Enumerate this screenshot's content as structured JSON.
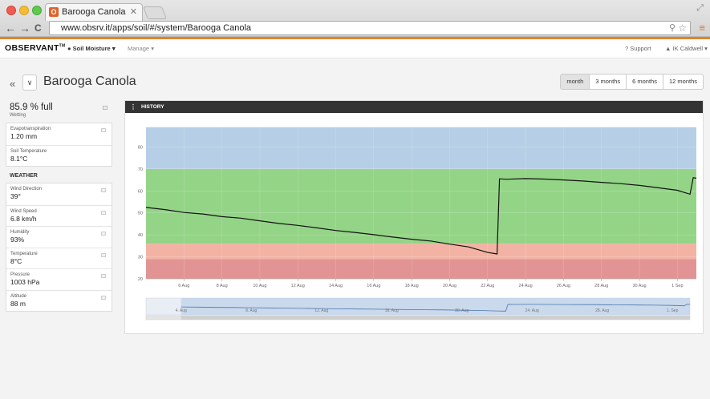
{
  "browser": {
    "tab_title": "Barooga Canola",
    "tab_favicon": "O",
    "tab_close": "✕",
    "url": "www.obsrv.it/apps/soil/#/system/Barooga Canola",
    "back_icon": "←",
    "forward_icon": "→",
    "reload_icon": "C",
    "menu_icon": "≡"
  },
  "app": {
    "logo": "OBSERVANT",
    "logo_tm": "TM",
    "nav_soil": "Soil Moisture",
    "nav_manage": "Manage",
    "support": "Support",
    "user": "IK Caldwell"
  },
  "page": {
    "back": "«",
    "dropdown": "∨",
    "title": "Barooga Canola",
    "ranges": [
      "month",
      "3 months",
      "6 months",
      "12 months"
    ]
  },
  "soil": {
    "value": "85.9 % full",
    "status": "Wetting"
  },
  "soil_card": [
    {
      "label": "Evapotranspiration",
      "value": "1.20 mm"
    },
    {
      "label": "Soil Temperature",
      "value": "8.1°C"
    }
  ],
  "weather_title": "WEATHER",
  "weather": [
    {
      "label": "Wind Direction",
      "value": "39°"
    },
    {
      "label": "Wind Speed",
      "value": "6.8 km/h"
    },
    {
      "label": "Humidity",
      "value": "93%"
    },
    {
      "label": "Temperature",
      "value": "8°C"
    },
    {
      "label": "Pressure",
      "value": "1003 hPa"
    },
    {
      "label": "Altitude",
      "value": "88 m"
    }
  ],
  "history_title": "HISTORY",
  "colors": {
    "accent": "#e0842a",
    "band_blue": "#b7cfe6",
    "band_green": "#94d487",
    "band_pink": "#f2b3a4",
    "band_red": "#e29494"
  },
  "chart_data": {
    "type": "line",
    "title": "HISTORY",
    "ylim": [
      20,
      90
    ],
    "yticks": [
      20,
      30,
      40,
      50,
      60,
      70,
      80
    ],
    "xlim": [
      "2013-08-04",
      "2013-09-02"
    ],
    "xticks": [
      "6 Aug",
      "8 Aug",
      "10 Aug",
      "12 Aug",
      "14 Aug",
      "16 Aug",
      "18 Aug",
      "20 Aug",
      "22 Aug",
      "24 Aug",
      "26 Aug",
      "28 Aug",
      "30 Aug",
      "1 Sep"
    ],
    "bands": [
      {
        "from": 70,
        "to": 89,
        "color": "#b7cfe6"
      },
      {
        "from": 36,
        "to": 70,
        "color": "#94d487"
      },
      {
        "from": 29,
        "to": 36,
        "color": "#f2b3a4"
      },
      {
        "from": 20,
        "to": 29,
        "color": "#e29494"
      }
    ],
    "series": [
      {
        "points": [
          [
            "2013-08-04T00:00",
            52.5
          ],
          [
            "2013-08-05T00:00",
            51.5
          ],
          [
            "2013-08-06T00:00",
            50.2
          ],
          [
            "2013-08-07T00:00",
            49.5
          ],
          [
            "2013-08-08T00:00",
            48.3
          ],
          [
            "2013-08-09T00:00",
            47.6
          ],
          [
            "2013-08-10T00:00",
            46.4
          ],
          [
            "2013-08-11T00:00",
            45.2
          ],
          [
            "2013-08-12T00:00",
            44.3
          ],
          [
            "2013-08-13T00:00",
            43.2
          ],
          [
            "2013-08-14T00:00",
            42.0
          ],
          [
            "2013-08-15T00:00",
            41.1
          ],
          [
            "2013-08-16T00:00",
            40.1
          ],
          [
            "2013-08-17T00:00",
            39.0
          ],
          [
            "2013-08-18T00:00",
            38.0
          ],
          [
            "2013-08-19T00:00",
            37.2
          ],
          [
            "2013-08-20T00:00",
            35.8
          ],
          [
            "2013-08-21T00:00",
            34.5
          ],
          [
            "2013-08-22T00:00",
            32.0
          ],
          [
            "2013-08-22T12:00",
            31.3
          ],
          [
            "2013-08-22T15:00",
            65.5
          ],
          [
            "2013-08-23T00:00",
            65.3
          ],
          [
            "2013-08-24T00:00",
            65.6
          ],
          [
            "2013-08-25T00:00",
            65.4
          ],
          [
            "2013-08-26T00:00",
            65.0
          ],
          [
            "2013-08-27T00:00",
            64.5
          ],
          [
            "2013-08-28T00:00",
            63.9
          ],
          [
            "2013-08-29T00:00",
            63.3
          ],
          [
            "2013-08-30T00:00",
            62.5
          ],
          [
            "2013-08-31T00:00",
            61.4
          ],
          [
            "2013-09-01T00:00",
            60.3
          ],
          [
            "2013-09-01T16:00",
            58.5
          ],
          [
            "2013-09-01T20:00",
            66.0
          ],
          [
            "2013-09-02T00:00",
            65.8
          ]
        ]
      }
    ],
    "navigator_xticks": [
      "4. Aug",
      "8. Aug",
      "12. Aug",
      "16. Aug",
      "20. Aug",
      "24. Aug",
      "28. Aug",
      "1. Sep"
    ],
    "navigator_xlim": [
      "2013-08-02",
      "2013-09-02"
    ]
  }
}
